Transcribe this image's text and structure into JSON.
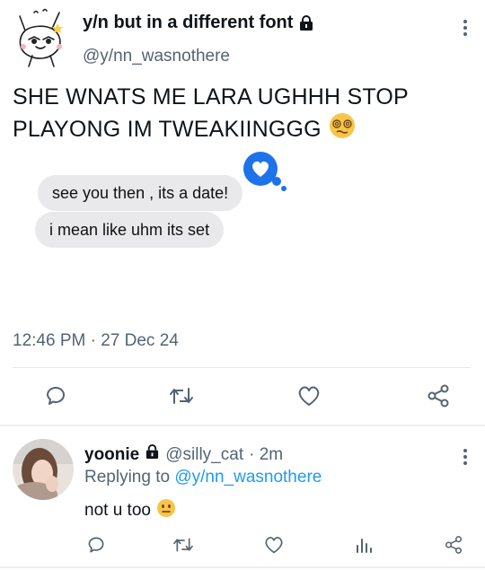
{
  "tweet": {
    "display_name": "y/n but in a different font",
    "handle": "@y/nn_wasnothere",
    "text_line1": "SHE WNATS ME LARA UGHHH STOP",
    "text_line2": "PLAYONG IM TWEAKIINGGG",
    "text_emoji": "woozy-face",
    "timestamp": "12:46 PM · 27 Dec 24",
    "locked": true
  },
  "embedded_chat": {
    "messages": [
      "see you then , its a date!",
      "i mean like uhm its set"
    ],
    "tapback": "heart"
  },
  "actions": [
    "reply-icon",
    "retweet-icon",
    "like-icon",
    "share-icon"
  ],
  "reply": {
    "display_name": "yoonie",
    "handle": "@silly_cat",
    "time": "· 2m",
    "replying_prefix": "Replying to",
    "replying_to": "@y/nn_wasnothere",
    "text": "not u too",
    "text_emoji": "neutral-face",
    "locked": true,
    "actions": [
      "reply-icon",
      "retweet-icon",
      "like-icon",
      "stats-icon",
      "share-icon"
    ]
  },
  "colors": {
    "text": "#0f1419",
    "secondary": "#536471",
    "accent": "#1d9bf0",
    "bubble": "#e9e9eb",
    "icon": "#536471"
  }
}
